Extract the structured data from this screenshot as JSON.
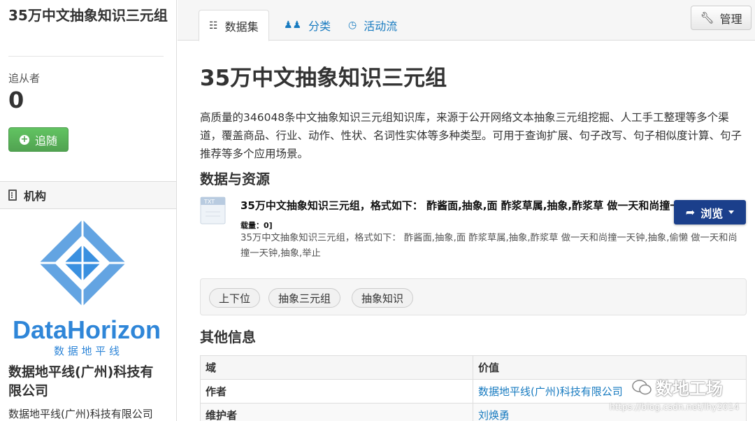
{
  "sidebar": {
    "title": "35万中文抽象知识三元组",
    "followers_label": "追从者",
    "followers_count": "0",
    "follow_button": "追随",
    "org_header": "机构",
    "logo_text": "DataHorizon",
    "logo_subtext": "数 据 地 平 线",
    "org_name": "数据地平线(广州)科技有限公司",
    "org_sub": "数据地平线(广州)科技有限公司"
  },
  "tabs": [
    {
      "label": "数据集",
      "icon": "sitemap-icon",
      "active": true
    },
    {
      "label": "分类",
      "icon": "users-icon",
      "active": false
    },
    {
      "label": "活动流",
      "icon": "clock-icon",
      "active": false
    }
  ],
  "manage_button": "管理",
  "dataset": {
    "title": "35万中文抽象知识三元组",
    "description": "高质量的346048条中文抽象知识三元组知识库，来源于公开网络文本抽象三元组挖掘、人工手工整理等多个渠道，覆盖商品、行业、动作、性状、名词性实体等多种类型。可用于查询扩展、句子改写、句子相似度计算、句子推荐等多个应用场景。"
  },
  "resources": {
    "heading": "数据与资源",
    "items": [
      {
        "icon_label": "TXT",
        "title": "35万中文抽象知识三元组，格式如下： 酢酱面,抽象,面 酢浆草属,抽象,酢浆草 做一天和尚撞一天钟,抽象,偷懒",
        "count": "载量：0]",
        "description": "35万中文抽象知识三元组，格式如下： 酢酱面,抽象,面 酢浆草属,抽象,酢浆草 做一天和尚撞一天钟,抽象,偷懒 做一天和尚撞一天钟,抽象,举止",
        "browse_label": "浏览"
      }
    ]
  },
  "tags": [
    "上下位",
    "抽象三元组",
    "抽象知识"
  ],
  "other_info": {
    "heading": "其他信息",
    "columns": [
      "域",
      "价值"
    ],
    "rows": [
      {
        "key": "作者",
        "value": "数据地平线(广州)科技有限公司"
      },
      {
        "key": "维护者",
        "value": "刘焕勇"
      }
    ]
  },
  "watermark": {
    "text": "数地工场",
    "url": "https://blog.csdn.net/lhy2014"
  },
  "colors": {
    "link": "#187bc0",
    "follow_green": "#51a351",
    "browse_navy": "#1b3f8b",
    "logo_blue": "#2f86d8"
  }
}
